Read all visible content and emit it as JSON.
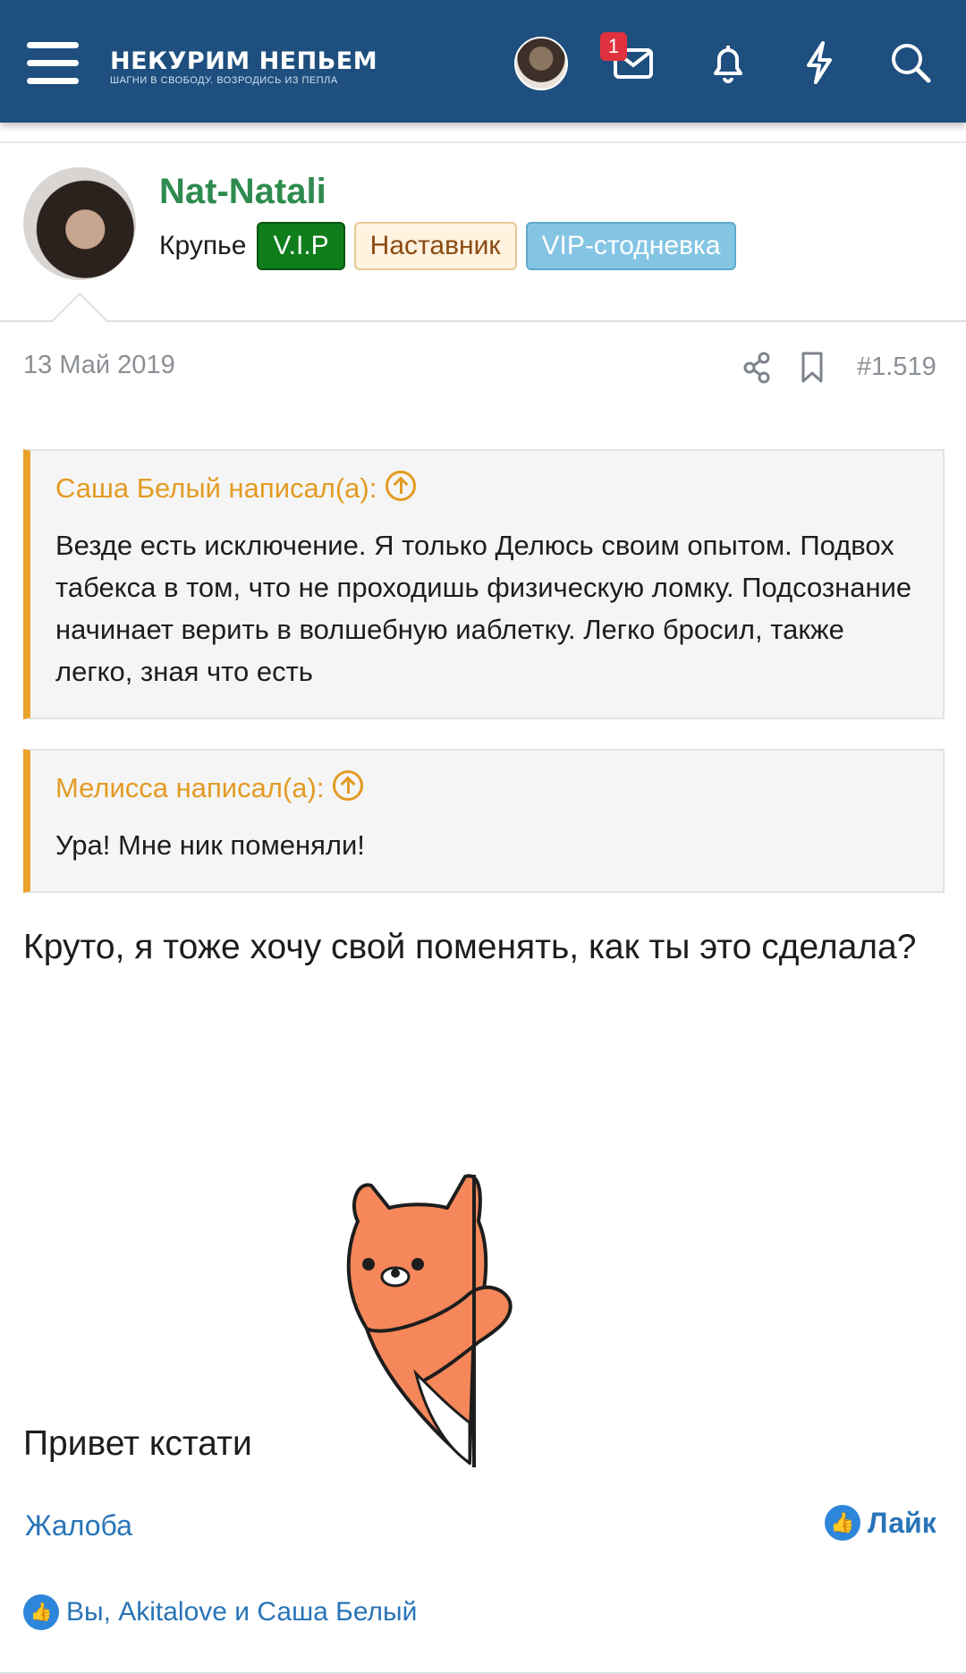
{
  "header": {
    "logo_text": "НЕКУРИМ НЕПЬЕМ",
    "logo_slogan": "ШАГНИ В СВОБОДУ. ВОЗРОДИСЬ ИЗ ПЕПЛА",
    "messages_badge": "1",
    "icons": [
      "menu-icon",
      "user-avatar",
      "envelope-icon",
      "bell-icon",
      "lightning-icon",
      "search-icon"
    ]
  },
  "author": {
    "name": "Nat-Natali",
    "role": "Крупье",
    "tags": [
      "V.I.P",
      "Наставник",
      "VIP-стодневка"
    ]
  },
  "post": {
    "date": "13 Май 2019",
    "number": "#1.519"
  },
  "quotes": [
    {
      "author": "Саша Белый написал(а):",
      "text": "Везде есть исключение. Я только Делюсь своим опытом. Подвох табекса в том, что не проходишь физическую ломку. Подсознание начинает верить в волшебную иаблетку. Легко бросил, также легко, зная что есть"
    },
    {
      "author": "Мелисса написал(а):",
      "text": "Ура! Мне ник поменяли!"
    }
  ],
  "message": {
    "text": "Круто, я тоже хочу свой поменять, как ты это сделала?",
    "greeting": "Привет кстати"
  },
  "actions": {
    "report": "Жалоба",
    "like": "Лайк",
    "likers": "Вы, Akitalove и Саша Белый"
  },
  "colors": {
    "header_bg": "#1e4f7e",
    "username": "#2e8b4f",
    "quote_accent": "#eba228",
    "link": "#2874b8"
  }
}
